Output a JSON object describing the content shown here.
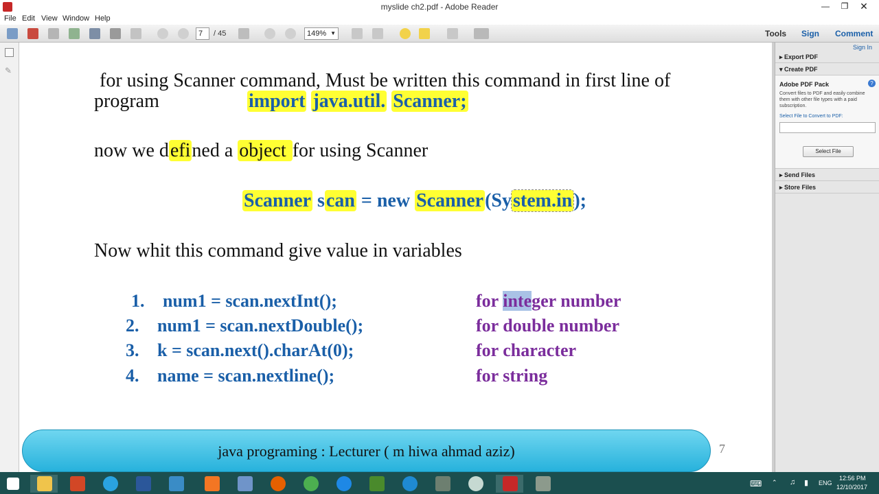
{
  "window": {
    "title": "myslide ch2.pdf - Adobe Reader"
  },
  "menu": [
    "File",
    "Edit",
    "View",
    "Window",
    "Help"
  ],
  "toolbar": {
    "page_current": "7",
    "page_total": "/ 45",
    "zoom": "149%",
    "tools_label": "Tools",
    "sign_label": "Sign",
    "comment_label": "Comment"
  },
  "slide": {
    "line1": {
      "a": "for using  Scanner command, Must be written this command in first line of"
    },
    "line2": {
      "a": "program",
      "import": "import",
      "java": "java.util.",
      "scanner": "Scanner;"
    },
    "line3": {
      "a": "now we d",
      "b": "efi",
      "c": "ned a ",
      "d": "object ",
      "e": "for using Scanner"
    },
    "line4": {
      "a": "Scanner",
      "b": "s",
      "c": "can",
      "d": "= new",
      "e": "Scanner",
      "f": "(Sy",
      "g": "stem.in",
      "h": ");"
    },
    "line5": "Now whit this command give value in variables",
    "list": [
      {
        "num": "1.",
        "code": "num1 = scan.nextInt();",
        "desc_pre": "for ",
        "desc_sel": "inte",
        "desc_post": "ger number"
      },
      {
        "num": "2.",
        "code": "num1 = scan.nextDouble();",
        "desc_pre": "for double number",
        "desc_sel": "",
        "desc_post": ""
      },
      {
        "num": "3.",
        "code": "k =  scan.next().charAt(0);",
        "desc_pre": "for character",
        "desc_sel": "",
        "desc_post": ""
      },
      {
        "num": "4.",
        "code": "name = scan.nextline();",
        "desc_pre": "for string",
        "desc_sel": "",
        "desc_post": ""
      }
    ],
    "footer": "java programing : Lecturer ( m hiwa ahmad aziz)",
    "page_number": "7"
  },
  "right_pane": {
    "sign_in": "Sign In",
    "export_pdf": "Export PDF",
    "create_pdf": "Create PDF",
    "pack_title": "Adobe PDF Pack",
    "pack_desc": "Convert files to PDF and easily combine them with other file types with a paid subscription.",
    "select_label": "Select File to Convert to PDF:",
    "select_button": "Select File",
    "send_files": "Send Files",
    "store_files": "Store Files"
  },
  "taskbar": {
    "lang": "ENG",
    "time": "12:56 PM",
    "date": "12/10/2017"
  },
  "colors": {
    "highlight": "#ffff33",
    "code_blue": "#1a5fa8",
    "purple": "#7b2d9c",
    "footer_cyan": "#27b2dc",
    "taskbar": "#1b4f4f"
  }
}
